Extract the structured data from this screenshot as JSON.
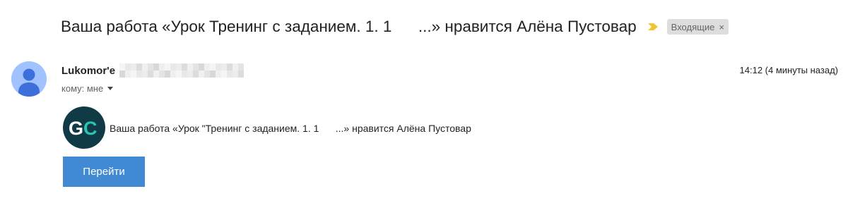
{
  "email": {
    "subject": "Ваша работа «Урок Тренинг с заданием. 1. 1      ...» нравится Алёна Пустовар",
    "label": {
      "text": "Входящие",
      "remove": "×"
    },
    "importance_icon": "importance-marker-icon",
    "sender": {
      "name": "Lukomor'e",
      "avatar_icon": "person-icon"
    },
    "timestamp": "14:12 (4 минуты назад)",
    "to": "кому: мне",
    "body": {
      "logo_icon": "gc-logo-icon",
      "text": "Ваша работа «Урок \"Тренинг с заданием. 1. 1      ...» нравится Алёна Пустовар",
      "button_label": "Перейти"
    }
  },
  "colors": {
    "accent_button": "#4189d2",
    "avatar_bg": "#a0c3ff",
    "avatar_fg": "#3c6fd9",
    "importance": "#f4c430",
    "label_chip_bg": "#dddddd",
    "logo_bg": "#0f3a46",
    "logo_letter_g": "#ffffff",
    "logo_letter_c": "#29c5b0"
  }
}
